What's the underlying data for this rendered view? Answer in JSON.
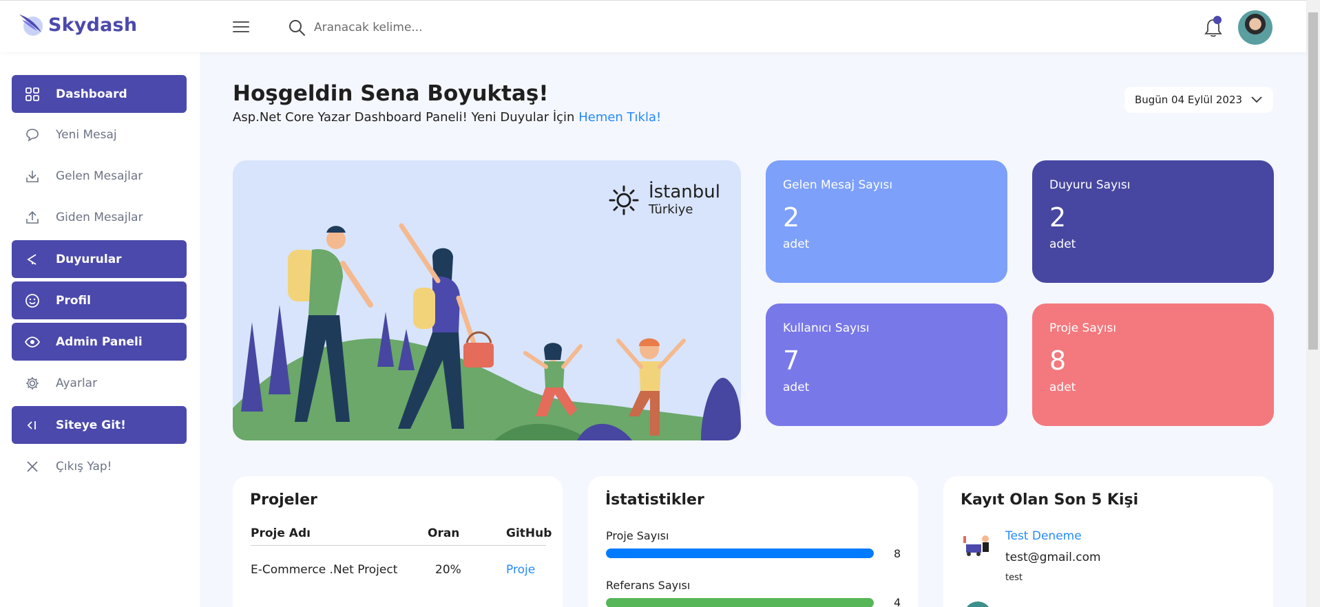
{
  "brand": {
    "name": "Skydash"
  },
  "search": {
    "placeholder": "Aranacak kelime..."
  },
  "sidebar": {
    "items": [
      {
        "label": "Dashboard",
        "icon": "grid-icon",
        "active": true
      },
      {
        "label": "Yeni Mesaj",
        "icon": "chat-icon",
        "active": false
      },
      {
        "label": "Gelen Mesajlar",
        "icon": "download-icon",
        "active": false
      },
      {
        "label": "Giden Mesajlar",
        "icon": "upload-icon",
        "active": false
      },
      {
        "label": "Duyurular",
        "icon": "megaphone-icon",
        "active": true
      },
      {
        "label": "Profil",
        "icon": "smiley-icon",
        "active": true
      },
      {
        "label": "Admin Paneli",
        "icon": "eye-icon",
        "active": true
      },
      {
        "label": "Ayarlar",
        "icon": "gear-icon",
        "active": false
      },
      {
        "label": "Siteye Git!",
        "icon": "back-arrow-icon",
        "active": true
      },
      {
        "label": "Çıkış Yap!",
        "icon": "close-icon",
        "active": false
      }
    ]
  },
  "welcome": {
    "title": "Hoşgeldin Sena Boyuktaş!",
    "subtitle": "Asp.Net Core Yazar Dashboard Paneli! Yeni Duyular İçin",
    "link": "Hemen Tıkla!"
  },
  "date_button": {
    "label": "Bugün 04 Eylül 2023"
  },
  "weather": {
    "city": "İstanbul",
    "country": "Türkiye",
    "icon": "sun-icon"
  },
  "stats": [
    {
      "label": "Gelen Mesaj Sayısı",
      "value": "2",
      "unit": "adet",
      "color": "#7da0fa"
    },
    {
      "label": "Duyuru Sayısı",
      "value": "2",
      "unit": "adet",
      "color": "#4747a1"
    },
    {
      "label": "Kullanıcı Sayısı",
      "value": "7",
      "unit": "adet",
      "color": "#7978e9"
    },
    {
      "label": "Proje Sayısı",
      "value": "8",
      "unit": "adet",
      "color": "#f3797e"
    }
  ],
  "projects": {
    "title": "Projeler",
    "headers": [
      "Proje Adı",
      "Oran",
      "GitHub"
    ],
    "rows": [
      {
        "name": "E-Commerce .Net Project",
        "ratio": "20%",
        "link": "Proje"
      }
    ]
  },
  "statistics": {
    "title": "İstatistikler",
    "items": [
      {
        "label": "Proje Sayısı",
        "value": "8",
        "fill": 1.0,
        "color": "#007bff"
      },
      {
        "label": "Referans Sayısı",
        "value": "4",
        "fill": 1.0,
        "color": "#57b657"
      }
    ]
  },
  "recent_users": {
    "title": "Kayıt Olan Son 5 Kişi",
    "items": [
      {
        "name": "Test Deneme",
        "email": "test@gmail.com",
        "username": "test"
      }
    ]
  }
}
